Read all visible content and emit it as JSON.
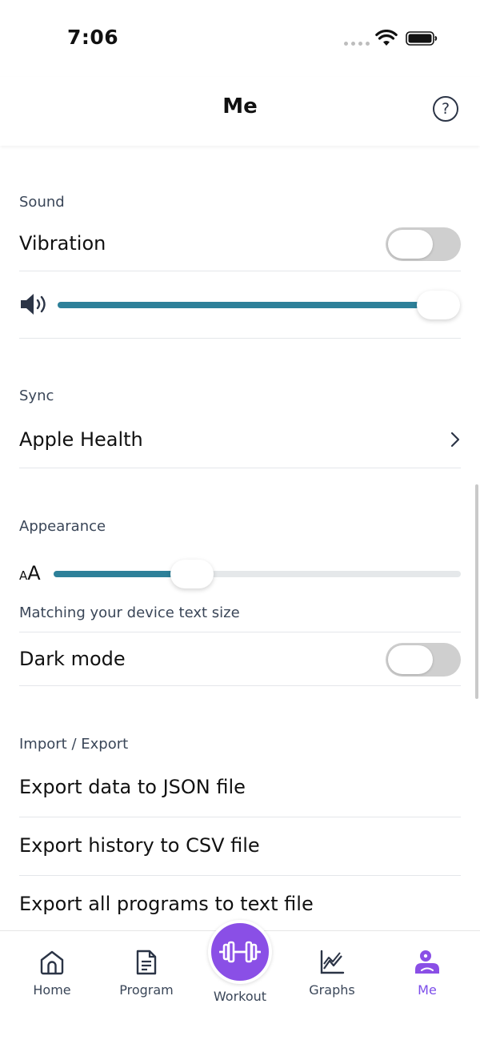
{
  "status_bar": {
    "time": "7:06"
  },
  "header": {
    "title": "Me",
    "help_label": "?"
  },
  "sections": {
    "sound": {
      "label": "Sound",
      "vibration_label": "Vibration",
      "vibration_on": false,
      "volume_level": 1.0
    },
    "sync": {
      "label": "Sync",
      "apple_health_label": "Apple Health"
    },
    "appearance": {
      "label": "Appearance",
      "text_size_small": "A",
      "text_size_big": "A",
      "text_size_level": 0.34,
      "text_size_caption": "Matching your device text size",
      "dark_mode_label": "Dark mode",
      "dark_mode_on": false
    },
    "import_export": {
      "label": "Import / Export",
      "items": [
        "Export data to JSON file",
        "Export history to CSV file",
        "Export all programs to text file"
      ]
    }
  },
  "tabs": [
    {
      "label": "Home",
      "icon": "home-icon",
      "active": false
    },
    {
      "label": "Program",
      "icon": "document-icon",
      "active": false
    },
    {
      "label": "Workout",
      "icon": "dumbbell-icon",
      "active": false
    },
    {
      "label": "Graphs",
      "icon": "graph-icon",
      "active": false
    },
    {
      "label": "Me",
      "icon": "profile-icon",
      "active": true
    }
  ],
  "colors": {
    "accent": "#8a4fe6",
    "slider": "#2d8099",
    "toggle_off": "#cfcfcf",
    "text_secondary": "#3a4658"
  }
}
